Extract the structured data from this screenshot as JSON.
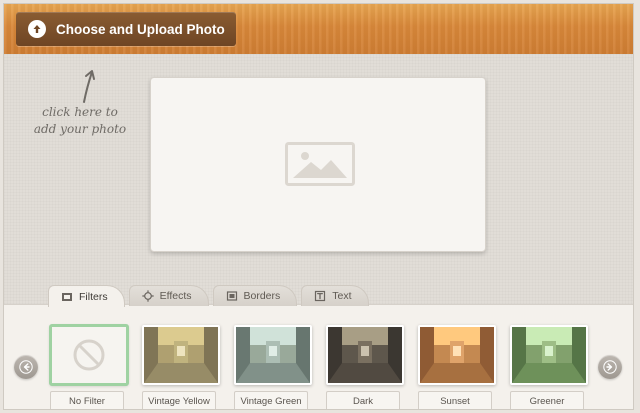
{
  "toolbar": {
    "upload_label": "Choose and Upload Photo"
  },
  "hint": {
    "line1": "click here to",
    "line2": "add your photo"
  },
  "tabs": [
    {
      "label": "Filters",
      "icon": "filters-icon",
      "active": true
    },
    {
      "label": "Effects",
      "icon": "effects-icon",
      "active": false
    },
    {
      "label": "Borders",
      "icon": "borders-icon",
      "active": false
    },
    {
      "label": "Text",
      "icon": "text-icon",
      "active": false
    }
  ],
  "filters": [
    {
      "label": "No Filter",
      "selected": true,
      "tint": "none"
    },
    {
      "label": "Vintage Yellow",
      "selected": false,
      "tint": "#e8d28a"
    },
    {
      "label": "Vintage Green",
      "selected": false,
      "tint": "#b9d6c6"
    },
    {
      "label": "Dark",
      "selected": false,
      "tint": "#6e6a62"
    },
    {
      "label": "Sunset",
      "selected": false,
      "tint": "#ffb35a"
    },
    {
      "label": "Greener",
      "selected": false,
      "tint": "#9bd78d"
    }
  ],
  "icons": {
    "upload": "upload-arrow-icon",
    "placeholder": "image-placeholder-icon",
    "prev": "arrow-left-icon",
    "next": "arrow-right-icon",
    "no_filter": "no-filter-icon"
  },
  "colors": {
    "accent_orange": "#d9883a",
    "button_brown": "#6e4524",
    "selected_green": "#9fd2a2"
  }
}
